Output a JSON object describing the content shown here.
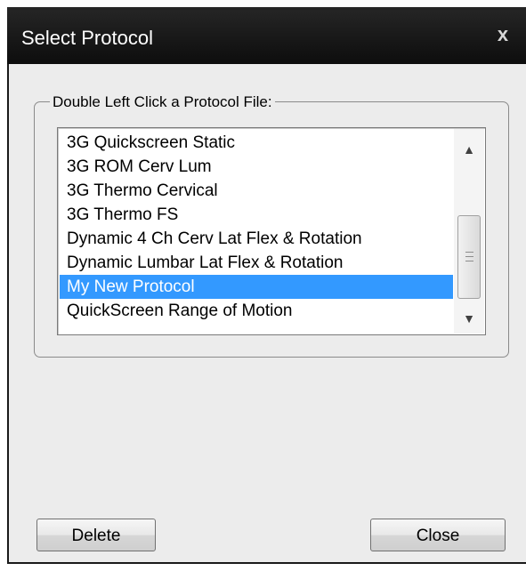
{
  "window": {
    "title": "Select Protocol",
    "close_glyph": "x"
  },
  "group": {
    "label": "Double Left Click a Protocol File:"
  },
  "protocol_list": {
    "items": [
      "3G Quickscreen Static",
      "3G ROM Cerv Lum",
      "3G Thermo Cervical",
      "3G Thermo FS",
      "Dynamic 4 Ch Cerv Lat Flex & Rotation",
      "Dynamic Lumbar Lat Flex & Rotation",
      "My New Protocol",
      "QuickScreen Range of Motion"
    ],
    "selected_item": "My New Protocol",
    "scroll_up_icon": "scroll-up-arrow-icon",
    "scroll_down_icon": "scroll-down-arrow-icon"
  },
  "buttons": {
    "delete_label": "Delete",
    "close_label": "Close"
  },
  "colors": {
    "titlebar": "#1a1a1a",
    "selection": "#3399ff",
    "window_bg": "#ececec"
  }
}
